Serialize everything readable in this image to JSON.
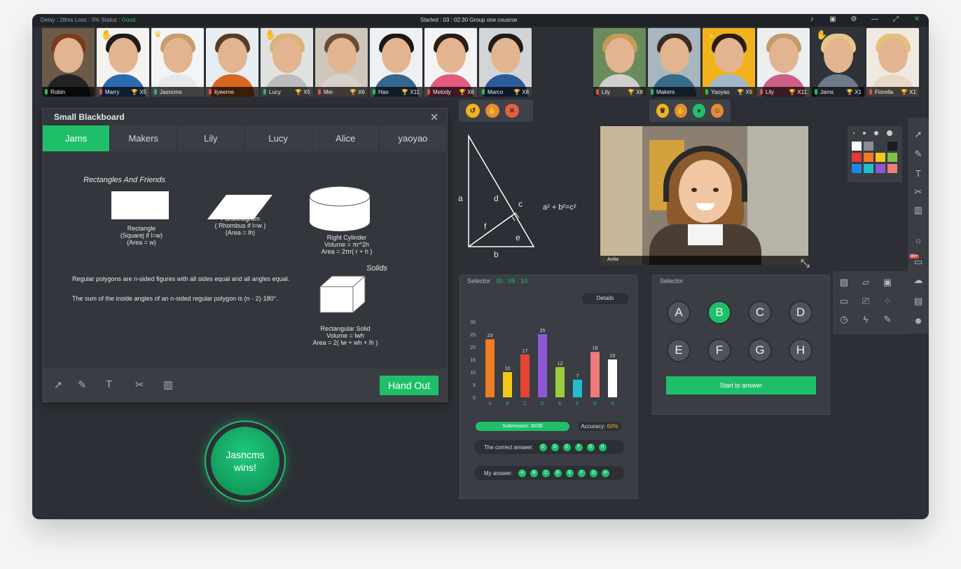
{
  "topbar": {
    "status_prefix": "Delay : 28ms  Loss : 0%  Status : ",
    "status_value": "Good",
    "center": "Started : 03 : 02:30   Group  one  cousrse"
  },
  "participants_left": [
    {
      "name": "Robin",
      "count": "",
      "bg": "#6c5a48",
      "hair": "#7a3a1e",
      "body": "#222222",
      "mic": "on"
    },
    {
      "name": "Marry",
      "count": "X5",
      "bg": "#f3f3ef",
      "hair": "#1f1a16",
      "body": "#2d6bb0",
      "mic": "off"
    },
    {
      "name": "Jasncms",
      "count": "",
      "bg": "#f2f4f6",
      "hair": "#c89b6a",
      "body": "#e7e7e7",
      "mic": "on"
    },
    {
      "name": "liyeerne",
      "count": "",
      "bg": "#e6edf3",
      "hair": "#5a3b22",
      "body": "#d8671c",
      "mic": "off"
    },
    {
      "name": "Lucy",
      "count": "X5",
      "bg": "#dfe2e0",
      "hair": "#d9b37a",
      "body": "#bcbcbc",
      "mic": "on"
    },
    {
      "name": "Mei",
      "count": "X6",
      "bg": "#cfc6bd",
      "hair": "#6a4b35",
      "body": "#d9d1c9",
      "mic": "off"
    },
    {
      "name": "Hao",
      "count": "X11",
      "bg": "#eef1f3",
      "hair": "#1b1815",
      "body": "#36668f",
      "mic": "on"
    },
    {
      "name": "Melody",
      "count": "X6",
      "bg": "#f3f3f3",
      "hair": "#2b1d14",
      "body": "#e35a7e",
      "mic": "off"
    },
    {
      "name": "Marco",
      "count": "X8",
      "bg": "#d2d4d6",
      "hair": "#1f1b18",
      "body": "#2d5b9a",
      "mic": "on"
    }
  ],
  "participants_right": [
    {
      "name": "Lily",
      "count": "X8",
      "bg": "#6a8c5c",
      "hair": "#c89a5a",
      "body": "#cfcfcf",
      "mic": "off"
    },
    {
      "name": "Makers",
      "count": "",
      "bg": "#a7b6bf",
      "hair": "#3a2a20",
      "body": "#3a6a8a",
      "mic": "on"
    },
    {
      "name": "Yaoyao",
      "count": "X9",
      "bg": "#f2b21b",
      "hair": "#2a1c14",
      "body": "#a2b8c9",
      "mic": "on"
    },
    {
      "name": "Lily",
      "count": "X11",
      "bg": "#eceff1",
      "hair": "#c79a6a",
      "body": "#cc5f86",
      "mic": "off"
    },
    {
      "name": "Jams",
      "count": "X1",
      "bg": "#2f3238",
      "hair": "#e4c68b",
      "body": "#6d7a8a",
      "mic": "on"
    },
    {
      "name": "Fiorella",
      "count": "X1",
      "bg": "#efe9e2",
      "hair": "#e3c07d",
      "body": "#e9d7c7",
      "mic": "off"
    }
  ],
  "blackboard": {
    "title": "Small Blackboard",
    "tabs": [
      "Jams",
      "Makers",
      "Lily",
      "Lucy",
      "Alice",
      "yaoyao"
    ],
    "heading_left": "Rectangles And Friends",
    "heading_right": "Solids",
    "rect": {
      "label": "Rectangle",
      "line2": "(Squarej  if  l=w)",
      "line3": "(Area = w)"
    },
    "para": {
      "label": "Parallelogram",
      "line2": "( Rhombus  if  l=w )",
      "line3": "(Area = lh)"
    },
    "cyl": {
      "label": "Right Cylinder",
      "line2": "Volume = πr^2h",
      "line3": "Area = 2πr( r + h )"
    },
    "solid": {
      "label": "Rectangular  Solid",
      "line2": "Volume = lwh",
      "line3": "Area = 2( lw + wh + lh )"
    },
    "text1": "Regular polygons are n-sided figures with all sides equal and all angles equal.",
    "text2": "The sum of the inside angles of an n-sided regular polygon is (n - 2)·180°.",
    "hand_out": "Hand Out"
  },
  "triangle": {
    "a": "a",
    "b": "b",
    "c": "c",
    "d": "d",
    "e": "e",
    "f": "f",
    "formula": "a² + b²=c²"
  },
  "winner": {
    "line1": "Jasncms",
    "line2": "wins!"
  },
  "video": {
    "name": "Anita"
  },
  "palette": {
    "colors": [
      "#ffffff",
      "#8a8d91",
      "#3a3d43",
      "#1b1d21",
      "#e53935",
      "#ef7d22",
      "#f2c81b",
      "#7dc242",
      "#1e88e5",
      "#1fbfd0",
      "#8e57d6",
      "#ef7b7b"
    ]
  },
  "selector_chart": {
    "title": "Selector",
    "timer": "00 : 05 : 10",
    "details": "Details",
    "submission": "Submission:  30/30",
    "accuracy_label": "Accuracy: ",
    "accuracy_value": "60%",
    "correct_label": "The correct answer:",
    "correct": [
      "C",
      "D",
      "E",
      "F",
      "G",
      "H"
    ],
    "my_label": "My answer:",
    "mine": [
      "A",
      "B",
      "C",
      "D",
      "E",
      "F",
      "G",
      "H"
    ]
  },
  "selector_options": {
    "title": "Selector",
    "options": [
      "A",
      "B",
      "C",
      "D",
      "E",
      "F",
      "G",
      "H"
    ],
    "selected": "B",
    "start": "Start to answer"
  },
  "chart_data": {
    "type": "bar",
    "categories": [
      "A",
      "B",
      "C",
      "D",
      "E",
      "F",
      "G",
      "H"
    ],
    "values": [
      23,
      10,
      17,
      25,
      12,
      7,
      18,
      15
    ],
    "colors": [
      "#ef7d22",
      "#f2c81b",
      "#e5452f",
      "#8e57d6",
      "#9ccc3c",
      "#1fbfd0",
      "#ef7b7b",
      "#ffffff"
    ],
    "ylim": [
      0,
      30
    ],
    "yticks": [
      0,
      5,
      10,
      15,
      20,
      25,
      30
    ],
    "label_color": "#1fbf6a"
  }
}
